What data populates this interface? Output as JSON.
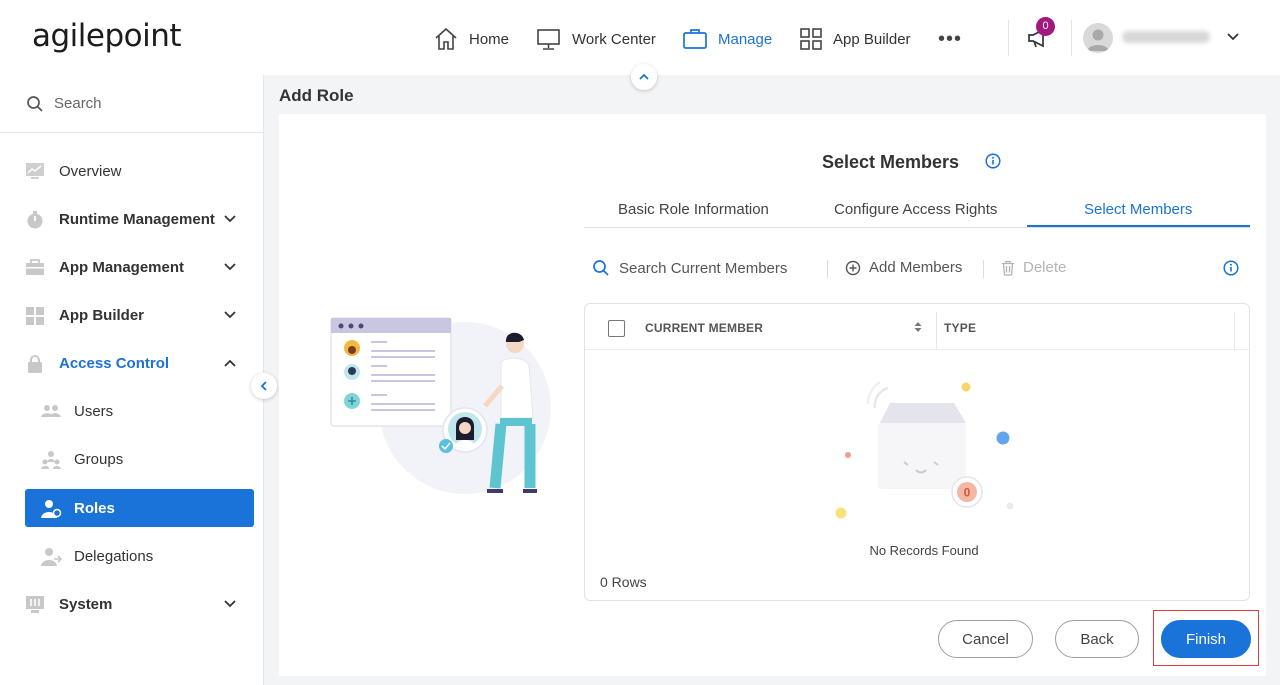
{
  "brand": {
    "logo_text": "agilepoint"
  },
  "topnav": {
    "items": [
      {
        "label": "Home",
        "icon": "home-icon"
      },
      {
        "label": "Work Center",
        "icon": "monitor-icon"
      },
      {
        "label": "Manage",
        "icon": "briefcase-icon",
        "active": true
      },
      {
        "label": "App Builder",
        "icon": "grid-icon"
      }
    ],
    "more_label": "•••",
    "notification_count": "0"
  },
  "sidebar": {
    "search_placeholder": "Search",
    "items": [
      {
        "label": "Overview",
        "icon": "chart-icon"
      },
      {
        "label": "Runtime Management",
        "icon": "stopwatch-icon",
        "expandable": true
      },
      {
        "label": "App Management",
        "icon": "toolbox-icon",
        "expandable": true
      },
      {
        "label": "App Builder",
        "icon": "grid-icon",
        "expandable": true
      },
      {
        "label": "Access Control",
        "icon": "lock-icon",
        "expanded": true
      },
      {
        "label": "Users",
        "icon": "users-icon"
      },
      {
        "label": "Groups",
        "icon": "groups-icon"
      },
      {
        "label": "Roles",
        "icon": "role-icon",
        "selected": true
      },
      {
        "label": "Delegations",
        "icon": "delegation-icon"
      },
      {
        "label": "System",
        "icon": "system-icon",
        "expandable": true
      }
    ]
  },
  "page": {
    "title": "Add Role"
  },
  "wizard": {
    "step_title": "Select Members",
    "tabs": [
      "Basic Role Information",
      "Configure Access Rights",
      "Select Members"
    ],
    "active_tab": 2
  },
  "toolbar": {
    "search_placeholder": "Search Current Members",
    "add_label": "Add Members",
    "delete_label": "Delete"
  },
  "grid": {
    "columns": [
      "CURRENT MEMBER",
      "TYPE"
    ],
    "empty_count": "0",
    "empty_text": "No Records Found",
    "rows_label": "0 Rows"
  },
  "actions": {
    "cancel": "Cancel",
    "back": "Back",
    "finish": "Finish"
  },
  "colors": {
    "accent": "#1a73d9",
    "badge": "#a0197b",
    "highlight": "#e0393e"
  }
}
